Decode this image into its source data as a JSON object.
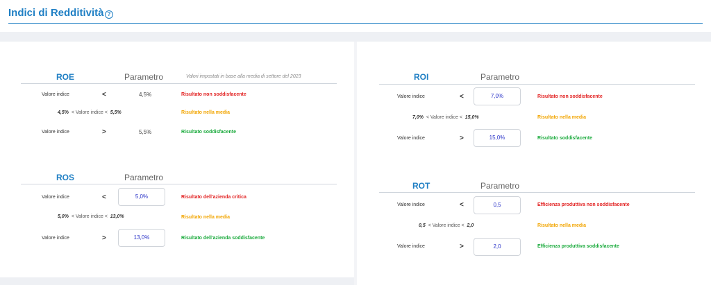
{
  "page": {
    "title": "Indici di Redditività",
    "help_icon": "?"
  },
  "tables": {
    "roe": {
      "code": "ROE",
      "param_label": "Parametro",
      "note": "Valori impostati in base alla media di settore del 2023",
      "rows": [
        {
          "label": "Valore indice",
          "op": "<",
          "value": "4,5%",
          "result": "Risultato non soddisfacente"
        },
        {
          "low": "4,5%",
          "mid_label": "< Valore indice <",
          "high": "5,5%",
          "result": "Risultato nella media"
        },
        {
          "label": "Valore indice",
          "op": ">",
          "value": "5,5%",
          "result": "Risultato soddisfacente"
        }
      ]
    },
    "ros": {
      "code": "ROS",
      "param_label": "Parametro",
      "rows": [
        {
          "label": "Valore indice",
          "op": "<",
          "value": "5,0%",
          "result": "Risultato dell'azienda critica"
        },
        {
          "low": "5,0%",
          "mid_label": "< Valore indice <",
          "high": "13,0%",
          "result": "Risultato nella media"
        },
        {
          "label": "Valore indice",
          "op": ">",
          "value": "13,0%",
          "result": "Risultato dell'azienda soddisfacente"
        }
      ]
    },
    "roi": {
      "code": "ROI",
      "param_label": "Parametro",
      "rows": [
        {
          "label": "Valore indice",
          "op": "<",
          "value": "7,0%",
          "result": "Risultato non soddisfacente"
        },
        {
          "low": "7,0%",
          "mid_label": "< Valore indice <",
          "high": "15,0%",
          "result": "Risultato nella media"
        },
        {
          "label": "Valore indice",
          "op": ">",
          "value": "15,0%",
          "result": "Risultato soddisfacente"
        }
      ]
    },
    "rot": {
      "code": "ROT",
      "param_label": "Parametro",
      "rows": [
        {
          "label": "Valore indice",
          "op": "<",
          "value": "0,5",
          "result": "Efficienza produttiva non soddisfacente"
        },
        {
          "low": "0,5",
          "mid_label": "< Valore indice <",
          "high": "2,0",
          "result": "Risultato nella media"
        },
        {
          "label": "Valore indice",
          "op": ">",
          "value": "2,0",
          "result": "Efficienza produttiva soddisfacente"
        }
      ]
    }
  },
  "colors": {
    "accent": "#1f7fc4",
    "bad": "#e22222",
    "medium": "#f2a500",
    "good": "#1aaa3c"
  }
}
